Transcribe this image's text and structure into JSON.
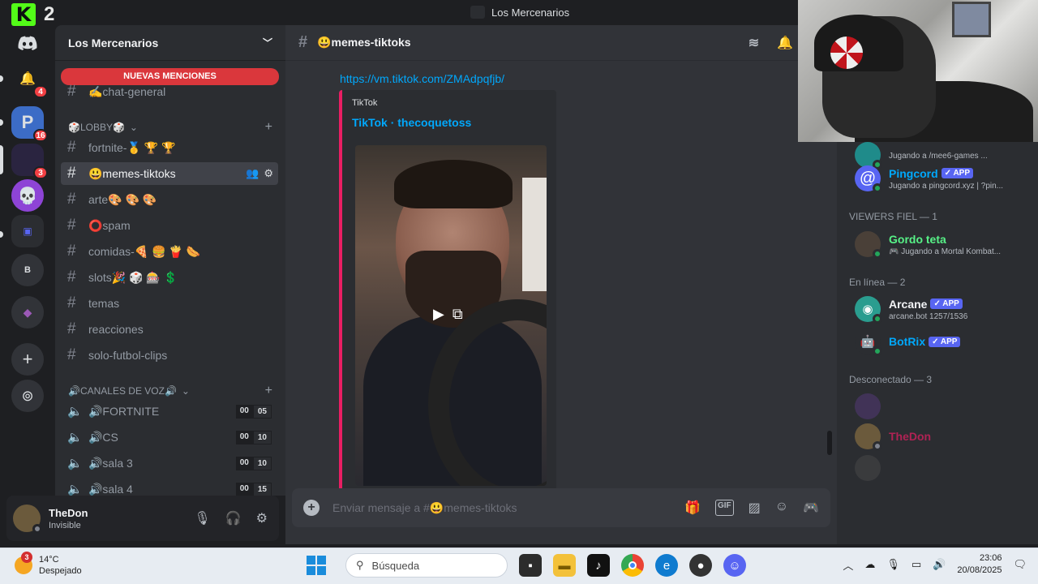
{
  "window": {
    "title": "Los Mercenarios"
  },
  "overlay": {
    "kick_logo": "K",
    "kick_count": "2"
  },
  "rail": {
    "servers": [
      {
        "name": "discord-home",
        "icon": "discord-icon",
        "badge": ""
      },
      {
        "name": "notifications",
        "icon": "bell-icon",
        "badge": "4"
      },
      {
        "name": "server-p",
        "icon": "P",
        "badge": "16"
      },
      {
        "name": "server-dark",
        "icon": "",
        "badge": "3"
      },
      {
        "name": "server-skull",
        "icon": "💀",
        "badge": ""
      },
      {
        "name": "server-folder",
        "icon": "",
        "badge": ""
      },
      {
        "name": "server-b",
        "icon": "B",
        "badge": ""
      },
      {
        "name": "server-purple",
        "icon": "",
        "badge": ""
      }
    ],
    "add_server": "+",
    "discover": "compass-icon"
  },
  "sidebar": {
    "server_name": "Los Mercenarios",
    "mentions_label": "NUEVAS MENCIONES",
    "channels_top": [
      {
        "name": "✍️chat-general"
      }
    ],
    "lobby_category": "🎲LOBBY🎲",
    "lobby_channels": [
      {
        "name": "fortnite-🥇 🏆 🏆"
      },
      {
        "name": "😃memes-tiktoks"
      },
      {
        "name": "arte🎨 🎨 🎨"
      },
      {
        "name": "⭕spam"
      },
      {
        "name": "comidas-🍕 🍔 🍟 🌭"
      },
      {
        "name": "slots🎉 🎲 🎰 💲"
      },
      {
        "name": "temas"
      },
      {
        "name": "reacciones"
      },
      {
        "name": "solo-futbol-clips"
      }
    ],
    "voice_category": "🔊CANALES DE VOZ🔊",
    "voice_channels": [
      {
        "name": "🔊FORTNITE",
        "a": "00",
        "b": "05"
      },
      {
        "name": "🔊CS",
        "a": "00",
        "b": "10"
      },
      {
        "name": "🔊sala 3",
        "a": "00",
        "b": "10"
      },
      {
        "name": "🔊sala 4",
        "a": "00",
        "b": "15"
      }
    ]
  },
  "user": {
    "name": "TheDon",
    "status": "Invisible"
  },
  "chat": {
    "channel": "😃memes-tiktoks",
    "link": "https://vm.tiktok.com/ZMAdpqfjb/",
    "embed_provider": "TikTok",
    "embed_title": "TikTok · thecoquetoss",
    "composer_placeholder": "Enviar mensaje a #😃memes-tiktoks"
  },
  "members": {
    "partial_activity": "Jugando a  /mee6-games ...",
    "items_top": [
      {
        "name": "Pingcord",
        "tag": "✓ APP",
        "activity": "Jugando a pingcord.xyz | ?pin...",
        "color": "#5865f2"
      }
    ],
    "group_viewers": "VIEWERS FIEL — 1",
    "viewers": [
      {
        "name": "Gordo teta",
        "activity": "🎮 Jugando a Mortal Kombat...",
        "color": "#57f287"
      }
    ],
    "group_online": "En línea — 2",
    "online": [
      {
        "name": "Arcane",
        "tag": "✓ APP",
        "activity": "arcane.bot 1257/1536",
        "color": "#5865f2"
      },
      {
        "name": "BotRix",
        "tag": "✓ APP",
        "activity": "",
        "color": "#5865f2"
      }
    ],
    "group_offline": "Desconectado — 3",
    "offline": [
      {
        "name": "TheDon",
        "color": "#e91e63"
      }
    ]
  },
  "taskbar": {
    "weather_temp": "14°C",
    "weather_desc": "Despejado",
    "weather_badge": "3",
    "search_placeholder": "Búsqueda",
    "time": "23:06",
    "date": "20/08/2025"
  },
  "colors": {
    "accent": "#5865f2",
    "link": "#00a8fc",
    "mention": "#da373c",
    "online": "#23a55a"
  }
}
